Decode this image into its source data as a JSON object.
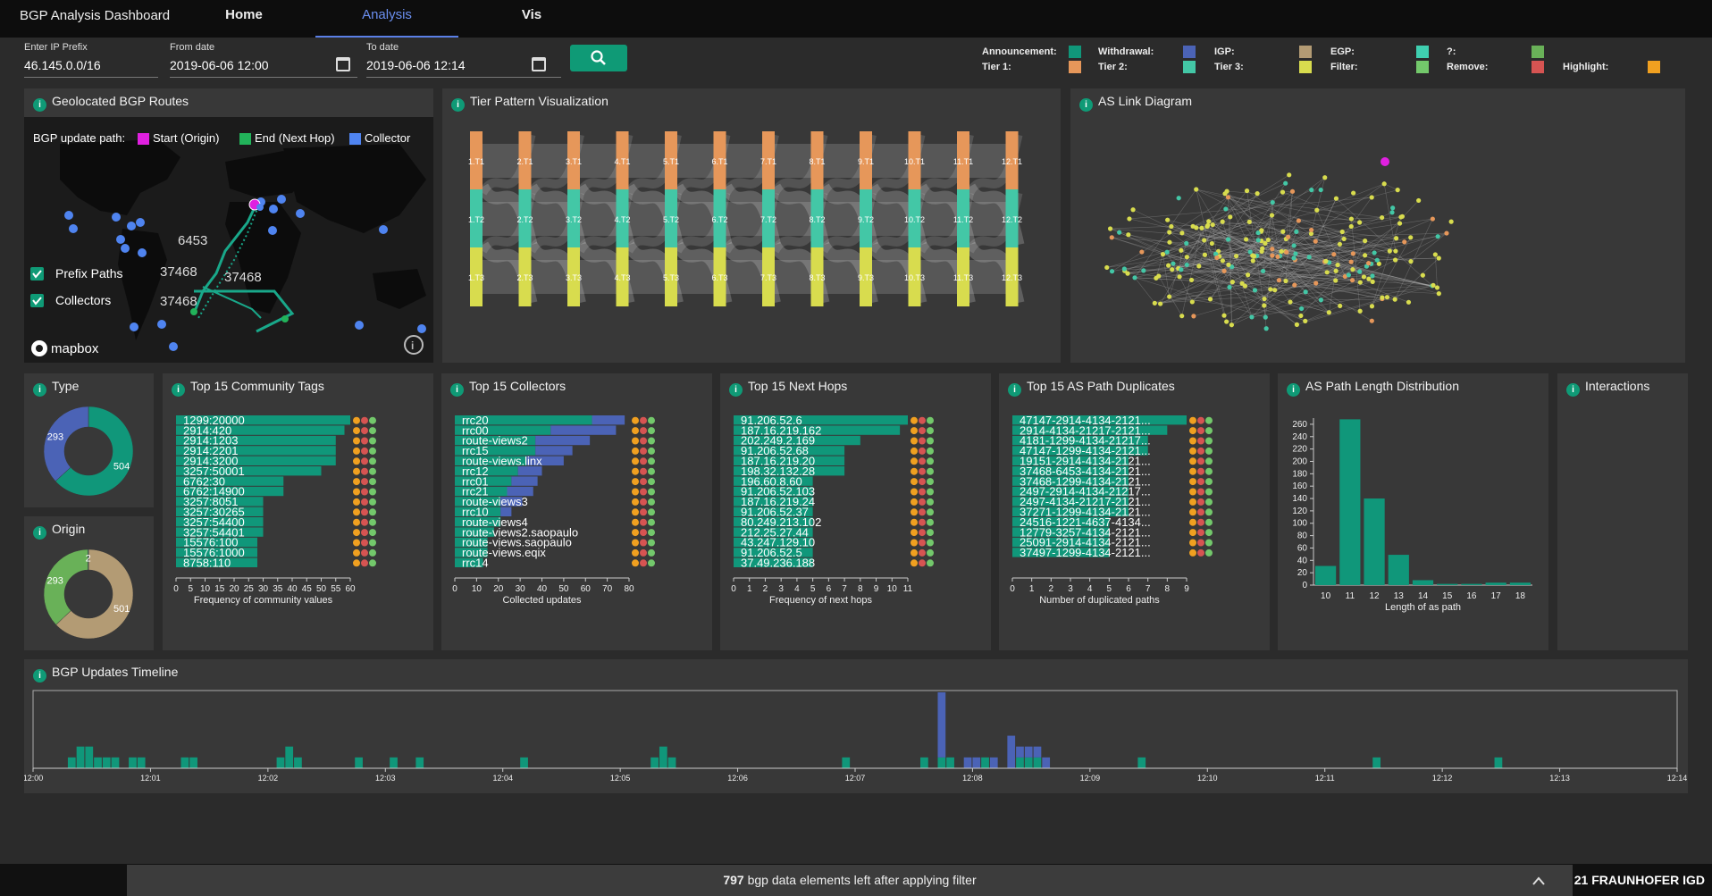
{
  "app": {
    "title": "BGP Analysis Dashboard"
  },
  "nav": {
    "tabs": [
      {
        "label": "Home"
      },
      {
        "label": "Analysis"
      },
      {
        "label": "Vis"
      }
    ],
    "active": "Analysis"
  },
  "filters": {
    "prefix_label": "Enter IP Prefix",
    "prefix_value": "46.145.0.0/16",
    "from_label": "From date",
    "from_value": "2019-06-06 12:00",
    "to_label": "To date",
    "to_value": "2019-06-06 12:14"
  },
  "legend": [
    {
      "label": "Announcement:",
      "color": "#10977a"
    },
    {
      "label": "Withdrawal:",
      "color": "#4b63b6"
    },
    {
      "label": "IGP:",
      "color": "#b39b74"
    },
    {
      "label": "EGP:",
      "color": "#3fcfb0"
    },
    {
      "label": "?:",
      "color": "#69b158"
    },
    {
      "label": "Tier 1:",
      "color": "#e6975a"
    },
    {
      "label": "Tier 2:",
      "color": "#43c7a6"
    },
    {
      "label": "Tier 3:",
      "color": "#d8dc4e"
    },
    {
      "label": "Filter:",
      "color": "#73c86b"
    },
    {
      "label": "Remove:",
      "color": "#d65452"
    },
    {
      "label": "Highlight:",
      "color": "#f0a020"
    }
  ],
  "panels": {
    "geo": "Geolocated BGP Routes",
    "tier": "Tier Pattern Visualization",
    "aslink": "AS Link Diagram",
    "type": "Type",
    "origin": "Origin",
    "community": "Top 15 Community Tags",
    "collectors": "Top 15 Collectors",
    "nexthops": "Top 15 Next Hops",
    "aspath": "Top 15 AS Path Duplicates",
    "aslen": "AS Path Length Distribution",
    "interactions": "Interactions",
    "timeline": "BGP Updates Timeline"
  },
  "map": {
    "path_label": "BGP update path:",
    "start_label": "Start (Origin)",
    "end_label": "End (Next Hop)",
    "collector_label": "Collector",
    "start_color": "#e020e0",
    "end_color": "#22b35a",
    "collector_color": "#4f84f0",
    "as_labels": [
      "6453",
      "37468",
      "37468",
      "37468"
    ],
    "toggles": [
      {
        "label": "Prefix Paths",
        "checked": true
      },
      {
        "label": "Collectors",
        "checked": true
      }
    ],
    "logo": "mapbox"
  },
  "tier": {
    "columns": [
      "1",
      "2",
      "3",
      "4",
      "5",
      "6",
      "7",
      "8",
      "9",
      "10",
      "11",
      "12"
    ],
    "rows": [
      {
        "suffix": "T1",
        "color": "#e6975a"
      },
      {
        "suffix": "T2",
        "color": "#43c7a6"
      },
      {
        "suffix": "T3",
        "color": "#d8dc4e"
      }
    ]
  },
  "footer": {
    "count": "797",
    "text": "bgp data elements left after applying filter",
    "copyright": "21 FRAUNHOFER IGD"
  },
  "chart_data": [
    {
      "id": "type",
      "type": "pie",
      "labels": [
        "Announcement",
        "Withdrawal"
      ],
      "values": [
        504,
        293
      ],
      "colors": [
        "#10977a",
        "#4b63b6"
      ]
    },
    {
      "id": "origin",
      "type": "pie",
      "labels": [
        "IGP",
        "?",
        "EGP"
      ],
      "values": [
        501,
        293,
        2
      ],
      "colors": [
        "#b39b74",
        "#69b158",
        "#3fcfb0"
      ]
    },
    {
      "id": "community",
      "type": "bar",
      "orientation": "horizontal",
      "xlabel": "Frequency of community values",
      "xticks": [
        0,
        5,
        10,
        15,
        20,
        25,
        30,
        35,
        40,
        45,
        50,
        55,
        60
      ],
      "xlim": [
        0,
        60
      ],
      "categories": [
        "1299:20000",
        "2914:420",
        "2914:1203",
        "2914:2201",
        "2914:3200",
        "3257:50001",
        "6762:30",
        "6762:14900",
        "3257:8051",
        "3257:30265",
        "3257:54400",
        "3257:54401",
        "15576:100",
        "15576:1000",
        "8758:110"
      ],
      "series": [
        {
          "values": [
            60,
            58,
            55,
            55,
            55,
            50,
            37,
            37,
            30,
            30,
            30,
            30,
            28,
            28,
            28
          ]
        }
      ]
    },
    {
      "id": "collectors",
      "type": "bar",
      "orientation": "horizontal",
      "stacked": true,
      "xlabel": "Collected updates",
      "xticks": [
        0,
        10,
        20,
        30,
        40,
        50,
        60,
        70,
        80
      ],
      "xlim": [
        0,
        80
      ],
      "categories": [
        "rrc20",
        "rrc00",
        "route-views2",
        "rrc15",
        "route-views.linx",
        "rrc12",
        "rrc01",
        "rrc21",
        "route-views3",
        "rrc10",
        "route-views4",
        "route-views2.saopaulo",
        "route-views.saopaulo",
        "route-views.eqix",
        "rrc14"
      ],
      "series": [
        {
          "name": "Announcement",
          "values": [
            63,
            44,
            37,
            37,
            33,
            29,
            26,
            24,
            21,
            21,
            21,
            18,
            15,
            15,
            13
          ]
        },
        {
          "name": "Withdrawal",
          "values": [
            15,
            30,
            25,
            17,
            17,
            11,
            12,
            12,
            10,
            5,
            0,
            0,
            0,
            0,
            0
          ]
        }
      ]
    },
    {
      "id": "nexthops",
      "type": "bar",
      "orientation": "horizontal",
      "xlabel": "Frequency of next hops",
      "xticks": [
        0,
        1,
        2,
        3,
        4,
        5,
        6,
        7,
        8,
        9,
        10,
        11
      ],
      "xlim": [
        0,
        11
      ],
      "categories": [
        "91.206.52.6",
        "187.16.219.162",
        "202.249.2.169",
        "91.206.52.68",
        "187.16.219.20",
        "198.32.132.28",
        "196.60.8.60",
        "91.206.52.103",
        "187.16.219.24",
        "91.206.52.37",
        "80.249.213.102",
        "212.25.27.44",
        "43.247.129.10",
        "91.206.52.5",
        "37.49.236.188"
      ],
      "series": [
        {
          "values": [
            11,
            10.5,
            8,
            7,
            7,
            7,
            5,
            5,
            5,
            5,
            5,
            5,
            5,
            5,
            5
          ]
        }
      ]
    },
    {
      "id": "aspath",
      "type": "bar",
      "orientation": "horizontal",
      "xlabel": "Number of duplicated paths",
      "xticks": [
        0,
        1,
        2,
        3,
        4,
        5,
        6,
        7,
        8,
        9
      ],
      "xlim": [
        0,
        9
      ],
      "categories": [
        "47147-2914-4134-2121...",
        "2914-4134-21217-2121...",
        "4181-1299-4134-21217...",
        "47147-1299-4134-2121...",
        "19151-2914-4134-2121...",
        "37468-6453-4134-2121...",
        "37468-1299-4134-2121...",
        "2497-2914-4134-21217...",
        "2497-4134-21217-2121...",
        "37271-1299-4134-2121...",
        "24516-1221-4637-4134...",
        "12779-3257-4134-2121...",
        "25091-2914-4134-2121...",
        "37497-1299-4134-2121..."
      ],
      "series": [
        {
          "values": [
            9,
            8,
            7,
            7,
            6,
            6,
            6,
            6,
            6,
            6,
            5,
            5,
            5,
            5
          ]
        }
      ]
    },
    {
      "id": "aslen",
      "type": "bar",
      "xlabel": "Length of as path",
      "categories": [
        "10",
        "11",
        "12",
        "13",
        "14",
        "15",
        "16",
        "17",
        "18"
      ],
      "yticks": [
        0,
        20,
        40,
        60,
        80,
        100,
        120,
        140,
        160,
        180,
        200,
        220,
        240,
        260
      ],
      "ylim": [
        0,
        270
      ],
      "series": [
        {
          "values": [
            31,
            268,
            140,
            49,
            8,
            2,
            2,
            4,
            4
          ]
        }
      ]
    },
    {
      "id": "timeline",
      "type": "bar",
      "stacked": true,
      "xticks": [
        "12:00",
        "12:01",
        "12:02",
        "12:03",
        "12:04",
        "12:05",
        "12:06",
        "12:07",
        "12:08",
        "12:09",
        "12:10",
        "12:11",
        "12:12",
        "12:13",
        "12:14"
      ],
      "bins": [
        0,
        0,
        0,
        0,
        0,
        0,
        0,
        0,
        0,
        0,
        0,
        0,
        0,
        0,
        0,
        0,
        0,
        0,
        0,
        0,
        0,
        0,
        0,
        0,
        0,
        0,
        0,
        0,
        0,
        0,
        0,
        0,
        0,
        0,
        0,
        0,
        0,
        0,
        0,
        0,
        0,
        0,
        0,
        0,
        0,
        0,
        0,
        0,
        0,
        0,
        0,
        0,
        0,
        0,
        0,
        0,
        0,
        0,
        0,
        0,
        0,
        0,
        0,
        0,
        0,
        0,
        0,
        0,
        0,
        0,
        0,
        0,
        0,
        0,
        0,
        0,
        0,
        0,
        0,
        0,
        0,
        0,
        0,
        0,
        0,
        0,
        0,
        0,
        0,
        0,
        0,
        0,
        0,
        0,
        0,
        0,
        0,
        0,
        0,
        0,
        0,
        0,
        0,
        0,
        0,
        0,
        0,
        0,
        0,
        0,
        0,
        0,
        0,
        0,
        0,
        0,
        0,
        0,
        0,
        0,
        0,
        0,
        0,
        0,
        0,
        0,
        0,
        0,
        0,
        0,
        0,
        0,
        0,
        0,
        0,
        0,
        0,
        0,
        0,
        0,
        0,
        0,
        0,
        0,
        0,
        0,
        0,
        0,
        0,
        0,
        0,
        0,
        0,
        0,
        0,
        0,
        0,
        0,
        0,
        0,
        0,
        0,
        0,
        0,
        0,
        0,
        0,
        0,
        0,
        0,
        0,
        0,
        0,
        0,
        0,
        0,
        0,
        0,
        0,
        0,
        0,
        0,
        0,
        0,
        0,
        0,
        0,
        0
      ],
      "series": [
        {
          "name": "Announcement",
          "values": [
            0,
            0,
            0,
            0,
            1,
            2,
            2,
            1,
            1,
            1,
            0,
            1,
            1,
            0,
            0,
            0,
            0,
            1,
            1,
            0,
            0,
            0,
            0,
            0,
            0,
            0,
            0,
            0,
            1,
            2,
            1,
            0,
            0,
            0,
            0,
            0,
            0,
            1,
            0,
            0,
            0,
            1,
            0,
            0,
            1,
            0,
            0,
            0,
            0,
            0,
            0,
            0,
            0,
            0,
            0,
            0,
            1,
            0,
            0,
            0,
            0,
            0,
            0,
            0,
            0,
            0,
            0,
            0,
            0,
            0,
            0,
            1,
            2,
            1,
            0,
            0,
            0,
            0,
            0,
            0,
            0,
            0,
            0,
            0,
            0,
            0,
            0,
            0,
            0,
            0,
            0,
            0,
            0,
            1,
            0,
            0,
            0,
            0,
            0,
            0,
            0,
            0,
            1,
            0,
            1,
            1,
            0,
            0,
            0,
            1,
            0,
            0,
            0,
            1,
            1,
            1,
            0,
            0,
            0,
            0,
            0,
            0,
            0,
            0,
            0,
            0,
            0,
            1,
            0,
            0,
            0,
            0,
            0,
            0,
            0,
            0,
            0,
            0,
            0,
            0,
            0,
            0,
            0,
            0,
            0,
            0,
            0,
            0,
            0,
            0,
            0,
            0,
            0,
            0,
            1,
            0,
            0,
            0,
            0,
            0,
            0,
            0,
            0,
            0,
            0,
            0,
            0,
            0,
            1,
            0,
            0,
            0,
            0,
            0,
            0,
            0,
            0,
            0,
            0,
            0,
            0,
            0,
            0,
            0,
            0,
            0,
            0,
            0,
            0
          ]
        },
        {
          "name": "Withdrawal",
          "values": [
            0,
            0,
            0,
            0,
            0,
            0,
            0,
            0,
            0,
            0,
            0,
            0,
            0,
            0,
            0,
            0,
            0,
            0,
            0,
            0,
            0,
            0,
            0,
            0,
            0,
            0,
            0,
            0,
            0,
            0,
            0,
            0,
            0,
            0,
            0,
            0,
            0,
            0,
            0,
            0,
            0,
            0,
            0,
            0,
            0,
            0,
            0,
            0,
            0,
            0,
            0,
            0,
            0,
            0,
            0,
            0,
            0,
            0,
            0,
            0,
            0,
            0,
            0,
            0,
            0,
            0,
            0,
            0,
            0,
            0,
            0,
            0,
            0,
            0,
            0,
            0,
            0,
            0,
            0,
            0,
            0,
            0,
            0,
            0,
            0,
            0,
            0,
            0,
            0,
            0,
            0,
            0,
            0,
            0,
            0,
            0,
            0,
            0,
            0,
            0,
            0,
            0,
            0,
            0,
            6,
            0,
            0,
            1,
            1,
            0,
            1,
            0,
            3,
            1,
            1,
            1,
            1,
            0,
            0,
            0,
            0,
            0,
            0,
            0,
            0,
            0,
            0,
            0,
            0,
            0,
            0,
            0,
            0,
            0,
            0,
            0,
            0,
            0,
            0,
            0,
            0,
            0,
            0,
            0,
            0,
            0,
            0,
            0,
            0,
            0,
            0,
            0,
            0,
            0,
            0,
            0,
            0,
            0,
            0,
            0,
            0,
            0,
            0,
            0,
            0,
            0,
            0,
            0,
            0,
            0,
            0,
            0,
            0,
            0,
            0,
            0,
            0,
            0,
            0,
            0,
            0,
            0,
            0,
            0,
            0,
            0,
            0,
            0,
            0
          ]
        }
      ]
    }
  ]
}
